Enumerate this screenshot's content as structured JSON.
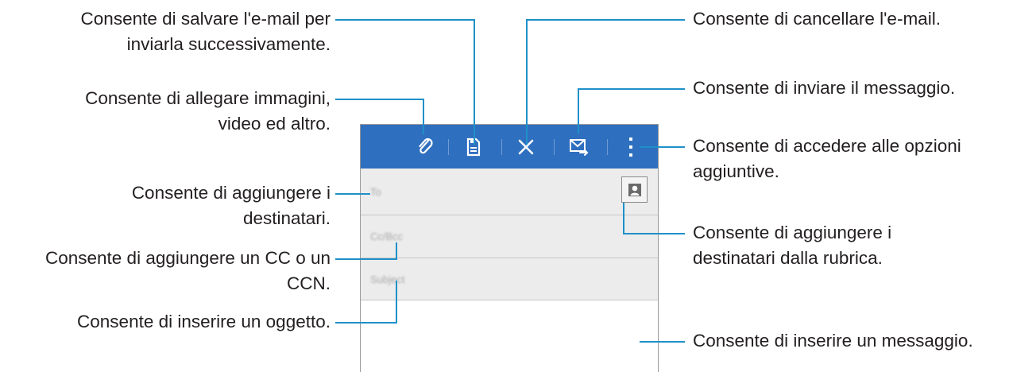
{
  "callouts": {
    "save": [
      "Consente di salvare l'e-mail per",
      "inviarla successivamente."
    ],
    "attach": [
      "Consente di allegare immagini,",
      "video ed altro."
    ],
    "recipients": [
      "Consente di aggiungere i",
      "destinatari."
    ],
    "cc": [
      "Consente di aggiungere un CC o un",
      "CCN."
    ],
    "subject": [
      "Consente di inserire un oggetto."
    ],
    "delete": [
      "Consente di cancellare l'e-mail."
    ],
    "send": [
      "Consente di inviare il messaggio."
    ],
    "options": [
      "Consente di accedere alle opzioni",
      "aggiuntive."
    ],
    "contacts": [
      "Consente di aggiungere i",
      "destinatari dalla rubrica."
    ],
    "message": [
      "Consente di inserire un messaggio."
    ]
  },
  "fields": {
    "to_placeholder": "To",
    "cc_placeholder": "Cc/Bcc",
    "subject_placeholder": "Subject"
  },
  "icons": [
    "paperclip-icon",
    "save-icon",
    "close-icon",
    "send-email-icon",
    "more-options-icon",
    "contact-icon"
  ],
  "colors": {
    "actionbar": "#2f6fbf",
    "callout_line": "#1f90c8",
    "field_bg": "#ececec"
  }
}
